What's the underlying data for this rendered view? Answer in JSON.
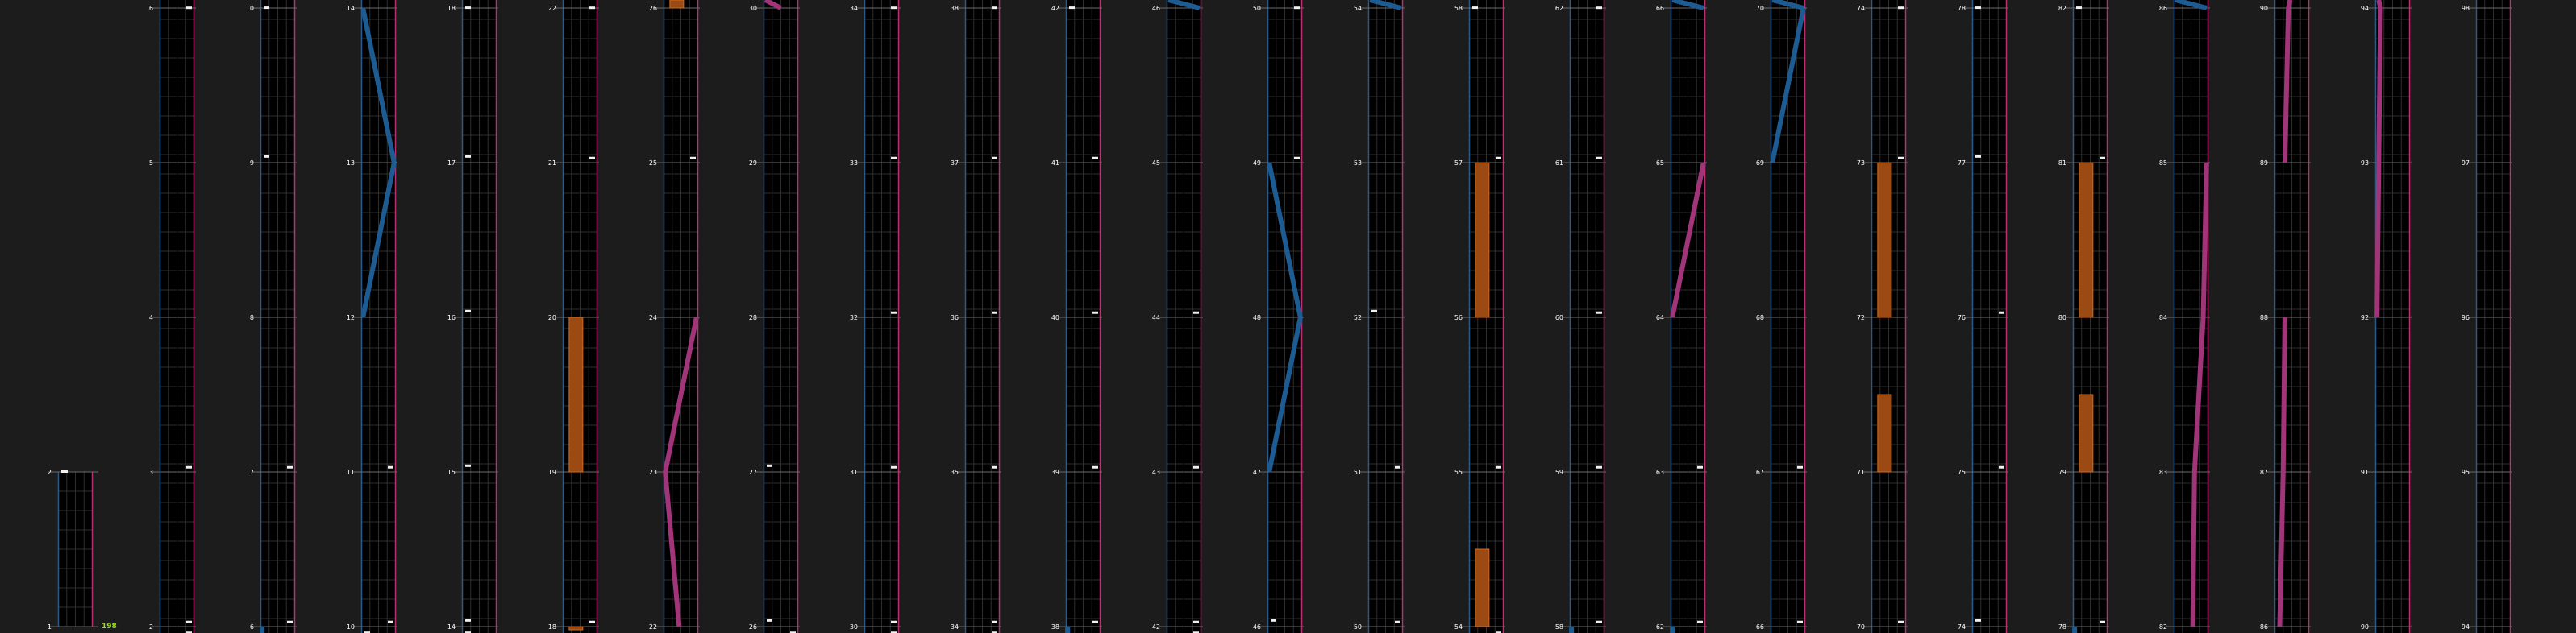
{
  "colors": {
    "background": "#1c1c1c",
    "panel_fill": "#000000",
    "row_line": "#6a6a6a",
    "grid_line": "#2e2e2e",
    "left_edge": "#2a5a8a",
    "right_edge": "#b8306f",
    "blue_stroke": "#1d5c93",
    "magenta_stroke": "#a2357a",
    "orange_block": "#9a4a12",
    "orange_edge": "#d16a20",
    "marker": "#f0f0f0",
    "label": "#ffffff",
    "highlight": "#9adc1e"
  },
  "highlight_value": "198",
  "first_column": {
    "top_label": "2",
    "bottom_label": "1"
  },
  "columns": [
    {
      "labels": [
        "2",
        "3",
        "4",
        "5",
        "6"
      ],
      "marks": [
        "m:0.95",
        "",
        "",
        "m:0.95",
        "m:0.95",
        "m:0.95"
      ]
    },
    {
      "labels": [
        "6",
        "7",
        "8",
        "9",
        "10"
      ],
      "marks": [
        "m:0.05",
        "m:0.05",
        "",
        "m:0.95",
        "m:0.95",
        "b:0.05-0.05"
      ]
    },
    {
      "labels": [
        "10",
        "11",
        "12",
        "13",
        "14"
      ],
      "marks": [
        "",
        "b:0.05-0.95",
        "b:0.95-0.05",
        "m:0.95",
        "m:0.95",
        "m:0.05"
      ]
    },
    {
      "labels": [
        "14",
        "15",
        "16",
        "17",
        "18"
      ],
      "marks": [
        "m:0.05",
        "m:0.05",
        "m:0.05",
        "m:0.05",
        "m:0.05",
        "m:0.05"
      ]
    },
    {
      "labels": [
        "18",
        "19",
        "20",
        "21",
        "22"
      ],
      "marks": [
        "m:0.55",
        "m:0.55",
        "",
        "o:0.0-1.0",
        "m:0.95",
        "o:0.0-0.5"
      ]
    },
    {
      "labels": [
        "22",
        "23",
        "24",
        "25",
        "26"
      ],
      "marks": [
        "o:0.0-1.0",
        "m:0.95",
        "",
        "p:0.95-0.05",
        "p:0.05-0.45",
        ""
      ]
    },
    {
      "labels": [
        "26",
        "27",
        "28",
        "29",
        "30"
      ],
      "marks": [
        "p:0.05-0.5",
        "",
        "",
        "m:0.05",
        "m:0.05",
        "m:0.95"
      ]
    },
    {
      "labels": [
        "30",
        "31",
        "32",
        "33",
        "34"
      ],
      "marks": [
        "m:0.95",
        "m:0.95",
        "m:0.95",
        "m:0.95",
        "m:0.95",
        "m:0.95"
      ]
    },
    {
      "labels": [
        "34",
        "35",
        "36",
        "37",
        "38"
      ],
      "marks": [
        "m:0.95",
        "m:0.95",
        "m:0.95",
        "m:0.95",
        "m:0.95",
        "m:0.95"
      ]
    },
    {
      "labels": [
        "38",
        "39",
        "40",
        "41",
        "42"
      ],
      "marks": [
        "m:0.05",
        "m:0.55",
        "m:0.95",
        "m:0.95",
        "m:0.95",
        "b:0.05-0.05"
      ]
    },
    {
      "labels": [
        "42",
        "43",
        "44",
        "45",
        "46"
      ],
      "marks": [
        "b:0.05-0.95",
        "",
        "m:0.95",
        "m:0.95",
        "m:0.95",
        "m:0.95"
      ]
    },
    {
      "labels": [
        "46",
        "47",
        "48",
        "49",
        "50"
      ],
      "marks": [
        "m:0.55",
        "m:0.5",
        "b:0.05-0.95",
        "b:0.95-0.05",
        "m:0.05",
        ""
      ]
    },
    {
      "labels": [
        "50",
        "51",
        "52",
        "53",
        "54"
      ],
      "marks": [
        "b:0.05-0.95",
        "",
        "m:0.05",
        "m:0.95",
        "m:0.95",
        ""
      ]
    },
    {
      "labels": [
        "54",
        "55",
        "56",
        "57",
        "58"
      ],
      "marks": [
        "m:0.05",
        "m:0.55",
        "o:0.0-1.0",
        "m:0.95",
        "o:0.5-1.0",
        "m:0.55"
      ]
    },
    {
      "labels": [
        "58",
        "59",
        "60",
        "61",
        "62"
      ],
      "marks": [
        "m:0.55",
        "m:0.55",
        "m:0.95",
        "m:0.95",
        "m:0.95",
        "b:0.05-0.05"
      ]
    },
    {
      "labels": [
        "62",
        "63",
        "64",
        "65",
        "66"
      ],
      "marks": [
        "b:0.05-0.95",
        "",
        "p:0.95-0.05",
        "m:0.95",
        "m:0.95",
        "b:0.05-0.05"
      ]
    },
    {
      "labels": [
        "66",
        "67",
        "68",
        "69",
        "70"
      ],
      "marks": [
        "b:0.05-0.95",
        "b:0.95-0.05",
        "",
        "m:0.95",
        "m:0.95",
        ""
      ]
    },
    {
      "labels": [
        "70",
        "71",
        "72",
        "73",
        "74"
      ],
      "marks": [
        "m:0.95",
        "m:0.55",
        "o:0.0-1.0",
        "o:0.5-1.0",
        "m:0.95",
        ""
      ]
    },
    {
      "labels": [
        "74",
        "75",
        "76",
        "77",
        "78"
      ],
      "marks": [
        "m:0.05",
        "m:0.05",
        "m:0.95",
        "m:0.95",
        "m:0.05",
        ""
      ]
    },
    {
      "labels": [
        "78",
        "79",
        "80",
        "81",
        "82"
      ],
      "marks": [
        "m:0.05",
        "m:0.95",
        "o:0.0-1.0",
        "o:0.5-1.0",
        "m:0.95",
        "b:0.05-0.05"
      ]
    },
    {
      "labels": [
        "82",
        "83",
        "84",
        "85",
        "86"
      ],
      "marks": [
        "b:0.05-0.95",
        "",
        "p:0.95-0.85",
        "p:0.85-0.6",
        "p:0.6-0.55",
        ""
      ]
    },
    {
      "labels": [
        "86",
        "87",
        "88",
        "89",
        "90"
      ],
      "marks": [
        "p:0.45-0.4",
        "p:0.4-0.3",
        "",
        "p:0.3-0.25",
        "p:0.25-0.15",
        ""
      ]
    },
    {
      "labels": [
        "90",
        "91",
        "92",
        "93",
        "94"
      ],
      "marks": [
        "p:0.1-0.15",
        "p:0.15-0.1",
        "p:0.1-0.05",
        "",
        "",
        ""
      ]
    },
    {
      "labels": [
        "94",
        "95",
        "96",
        "97",
        "98"
      ],
      "marks": [
        "",
        "",
        "",
        "",
        "",
        ""
      ]
    }
  ]
}
